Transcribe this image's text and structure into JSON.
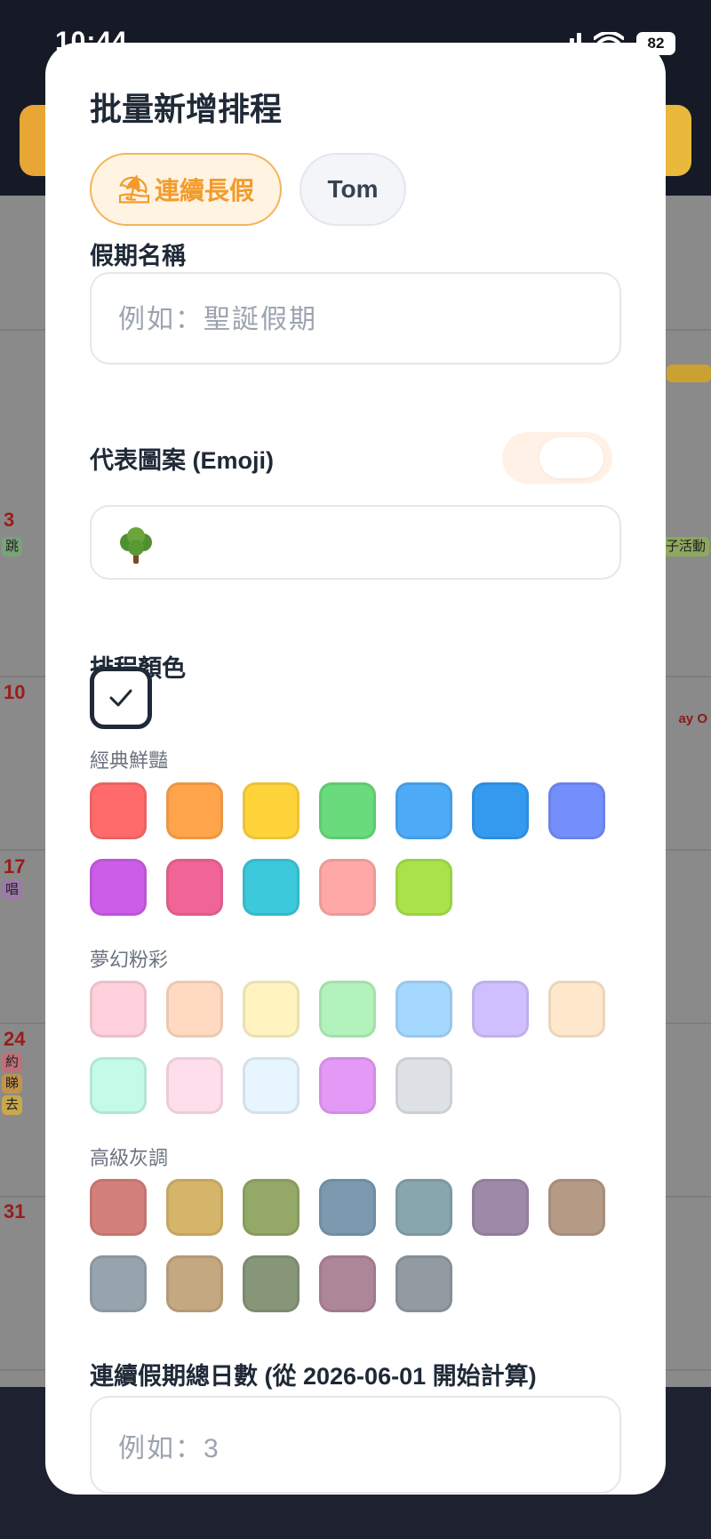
{
  "status": {
    "time": "10:44",
    "battery": "82"
  },
  "modal": {
    "title": "批量新增排程",
    "tabs": [
      {
        "label": "連續長假",
        "icon": "beach-umbrella-icon",
        "selected": true
      },
      {
        "label": "Tom",
        "selected": false
      }
    ],
    "holiday_name": {
      "label": "假期名稱",
      "placeholder": "例如：聖誕假期",
      "value": ""
    },
    "emoji": {
      "label": "代表圖案 (Emoji)",
      "toggle_on": false,
      "value": "🌳"
    },
    "color": {
      "label": "排程顏色",
      "selected_icon": "checkmark-icon",
      "groups": [
        {
          "name": "經典鮮豔",
          "colors": [
            "#ff6b6b",
            "#ffa44a",
            "#ffd43b",
            "#69db7c",
            "#4dabf7",
            "#339af0",
            "#748ffc",
            "#cc5de8",
            "#f06595",
            "#3bc9db",
            "#ffa8a8",
            "#a9e34b"
          ]
        },
        {
          "name": "夢幻粉彩",
          "colors": [
            "#ffd1dc",
            "#ffdac1",
            "#fff3bf",
            "#b2f2bb",
            "#a5d8ff",
            "#d0bfff",
            "#ffe8cc",
            "#c3fae8",
            "#ffdeeb",
            "#e7f5ff",
            "#e599f7",
            "#dee2e6"
          ]
        },
        {
          "name": "高級灰調",
          "colors": [
            "#d4807a",
            "#d4b56a",
            "#94a968",
            "#7b9aaf",
            "#87a6ad",
            "#9f89a9",
            "#b59a86",
            "#97a4ad",
            "#c3a882",
            "#879678",
            "#ad8698",
            "#929aa2"
          ]
        }
      ]
    },
    "days": {
      "label": "連續假期總日數 (從 2026-06-01 開始計算)",
      "placeholder": "例如：3"
    }
  },
  "background": {
    "days": [
      "3",
      "10",
      "17",
      "24",
      "31"
    ],
    "chips": [
      "跳",
      "唱",
      "約",
      "睇",
      "去",
      "子活動",
      "ay O"
    ]
  }
}
